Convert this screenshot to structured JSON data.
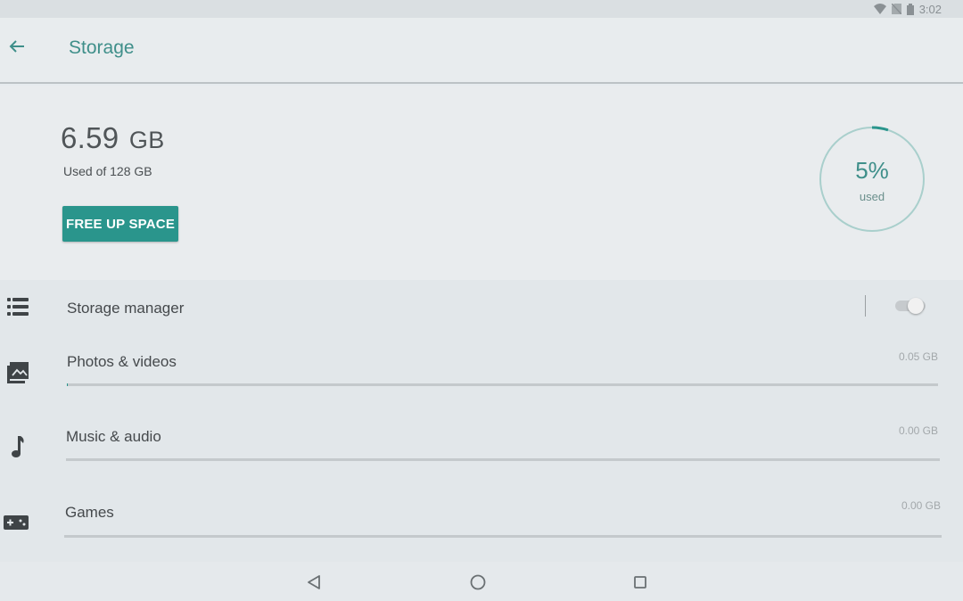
{
  "status_bar": {
    "time": "3:02",
    "icons": [
      "wifi-icon",
      "no-sim-icon",
      "battery-icon"
    ]
  },
  "header": {
    "back_icon": "arrow-back-icon",
    "title": "Storage"
  },
  "summary": {
    "used_value": "6.59",
    "used_unit": "GB",
    "used_of": "Used of 128 GB",
    "free_up_button": "FREE UP SPACE",
    "percent_label": "5%",
    "percent_caption": "used",
    "percent_used": 5,
    "accent_color": "#2a958c"
  },
  "list": {
    "items": [
      {
        "icon": "storage-manager-icon",
        "label": "Storage manager",
        "toggle_on": false
      },
      {
        "icon": "photos-icon",
        "label": "Photos & videos",
        "size": "0.05 GB",
        "fraction": 0.0004
      },
      {
        "icon": "music-note-icon",
        "label": "Music & audio",
        "size": "0.00 GB",
        "fraction": 0
      },
      {
        "icon": "gamepad-icon",
        "label": "Games",
        "size": "0.00 GB",
        "fraction": 0
      }
    ]
  },
  "nav_bar": {
    "icons": [
      "nav-back-icon",
      "nav-home-icon",
      "nav-recents-icon"
    ]
  }
}
